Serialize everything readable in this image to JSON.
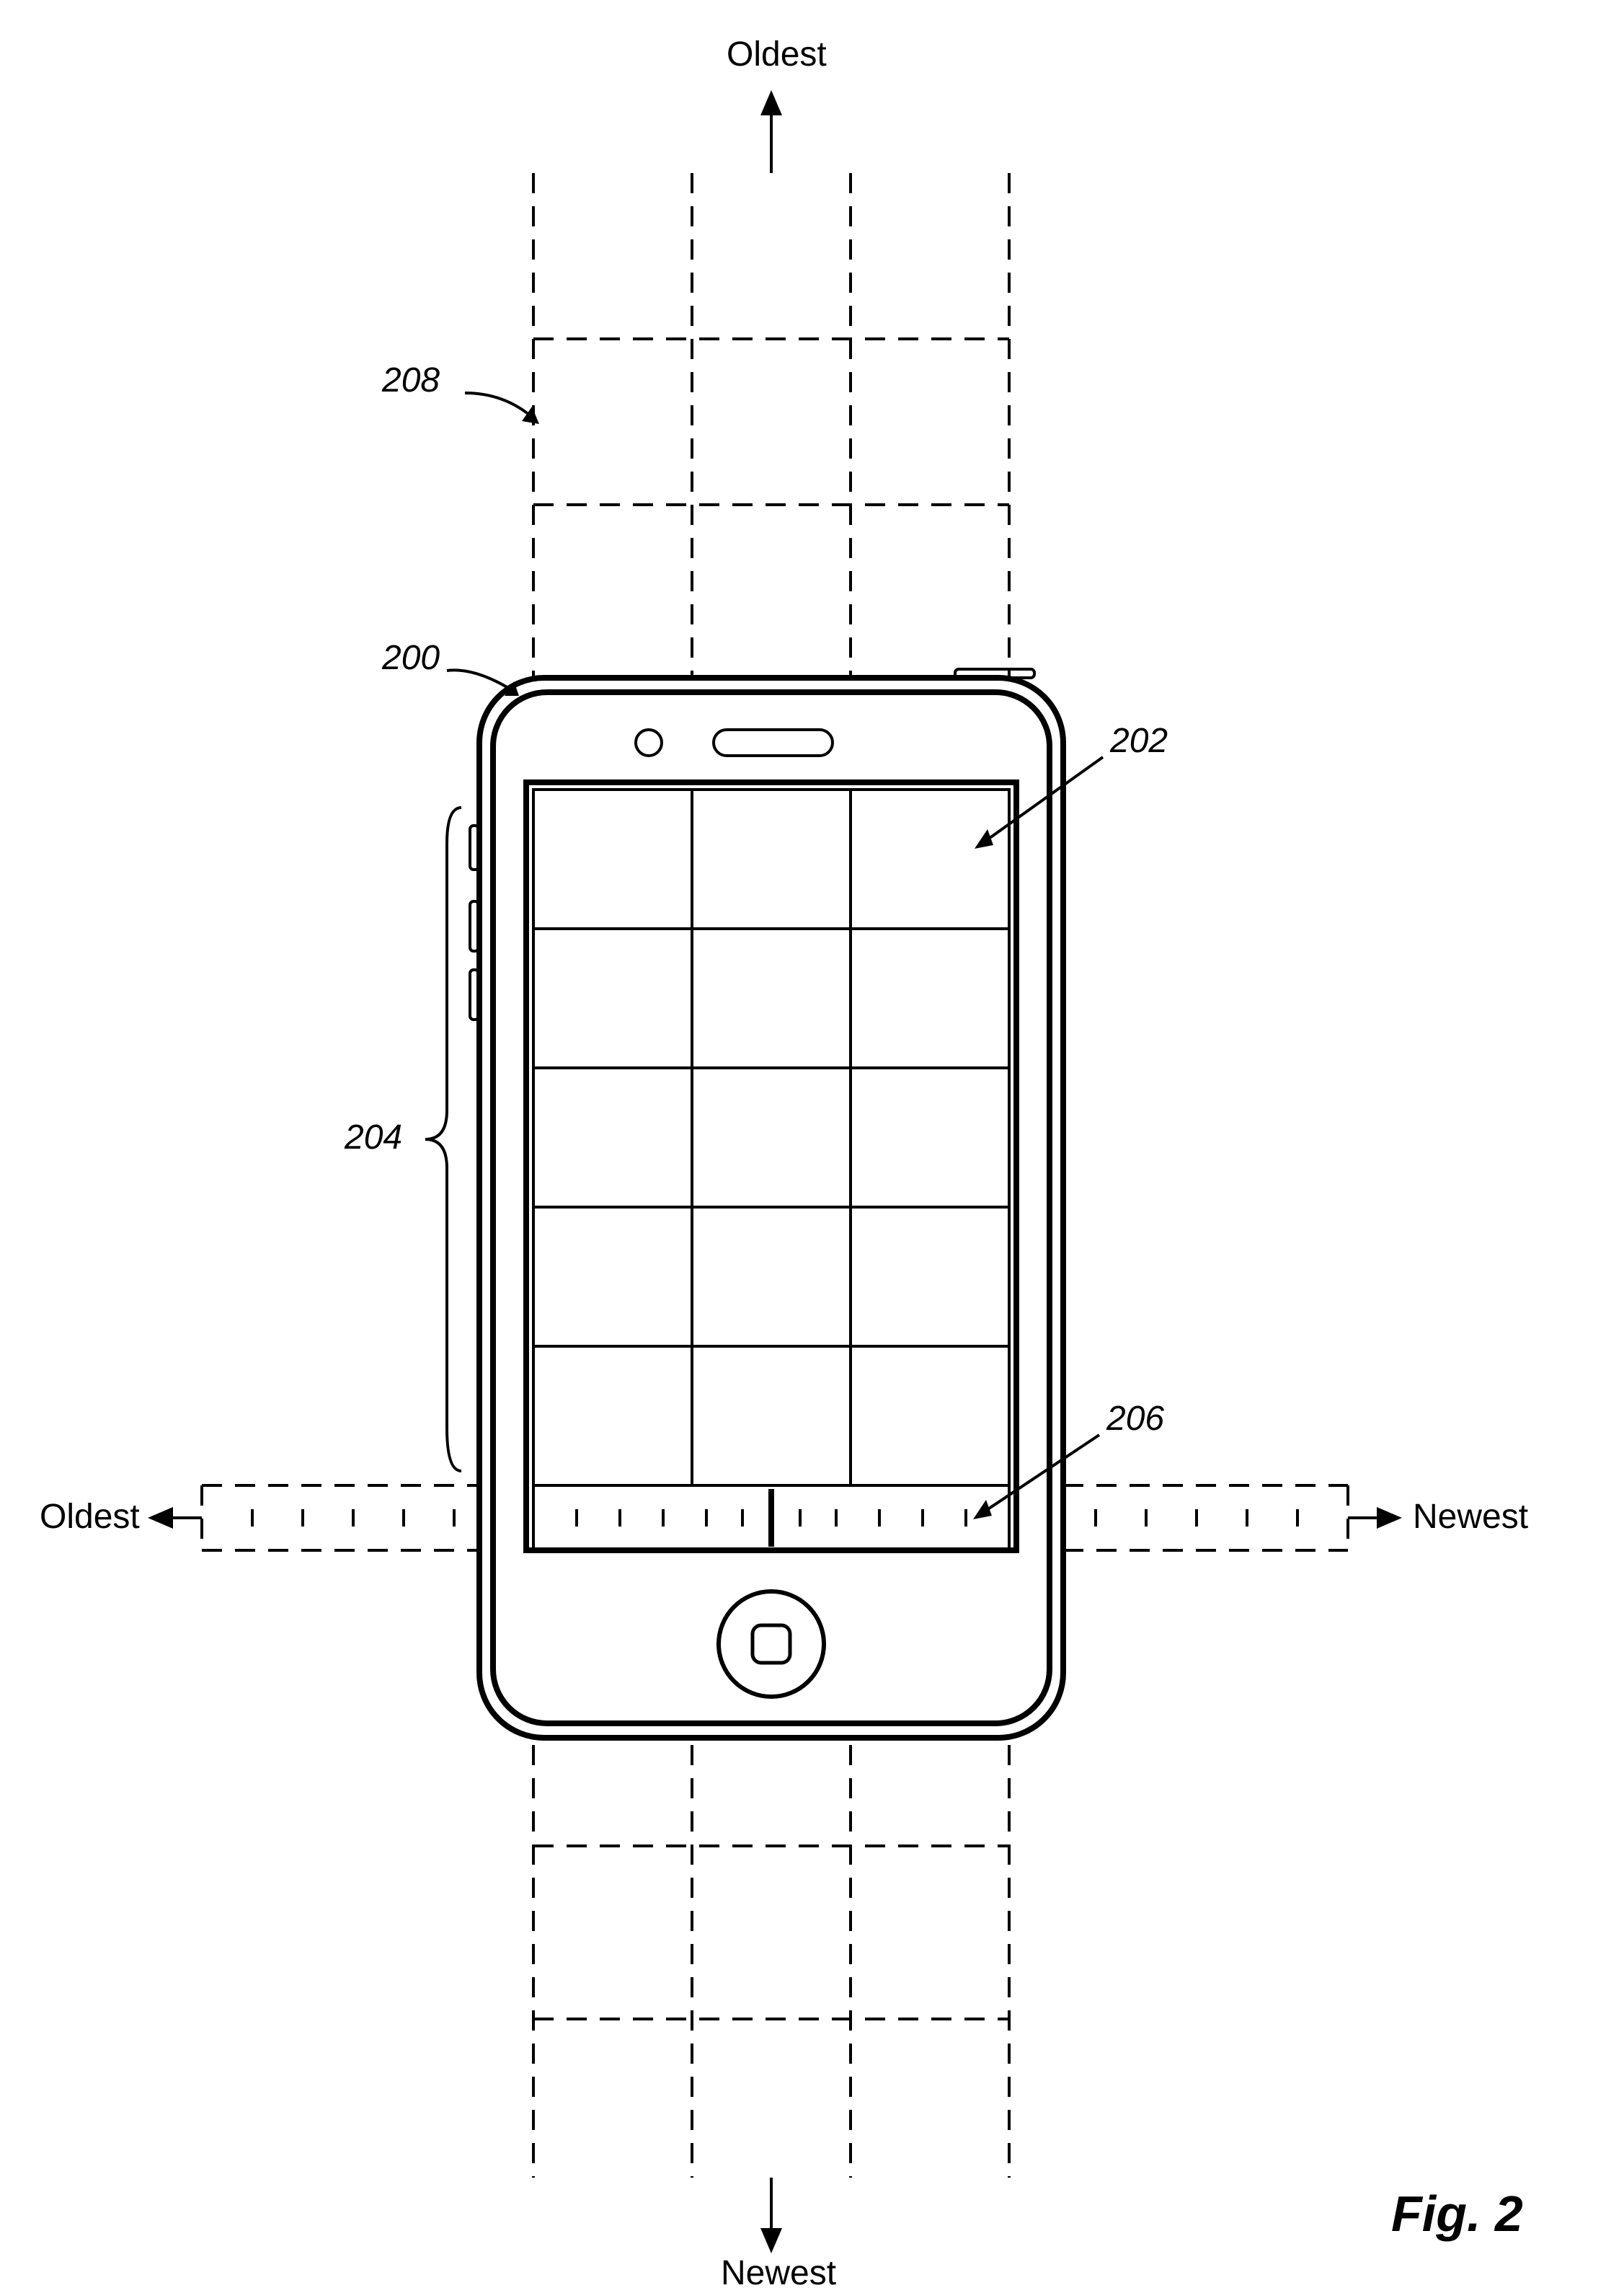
{
  "labels": {
    "oldest_top": "Oldest",
    "newest_bottom": "Newest",
    "oldest_left": "Oldest",
    "newest_right": "Newest",
    "ref_200": "200",
    "ref_202": "202",
    "ref_204": "204",
    "ref_206": "206",
    "ref_208": "208",
    "figure": "Fig. 2"
  }
}
